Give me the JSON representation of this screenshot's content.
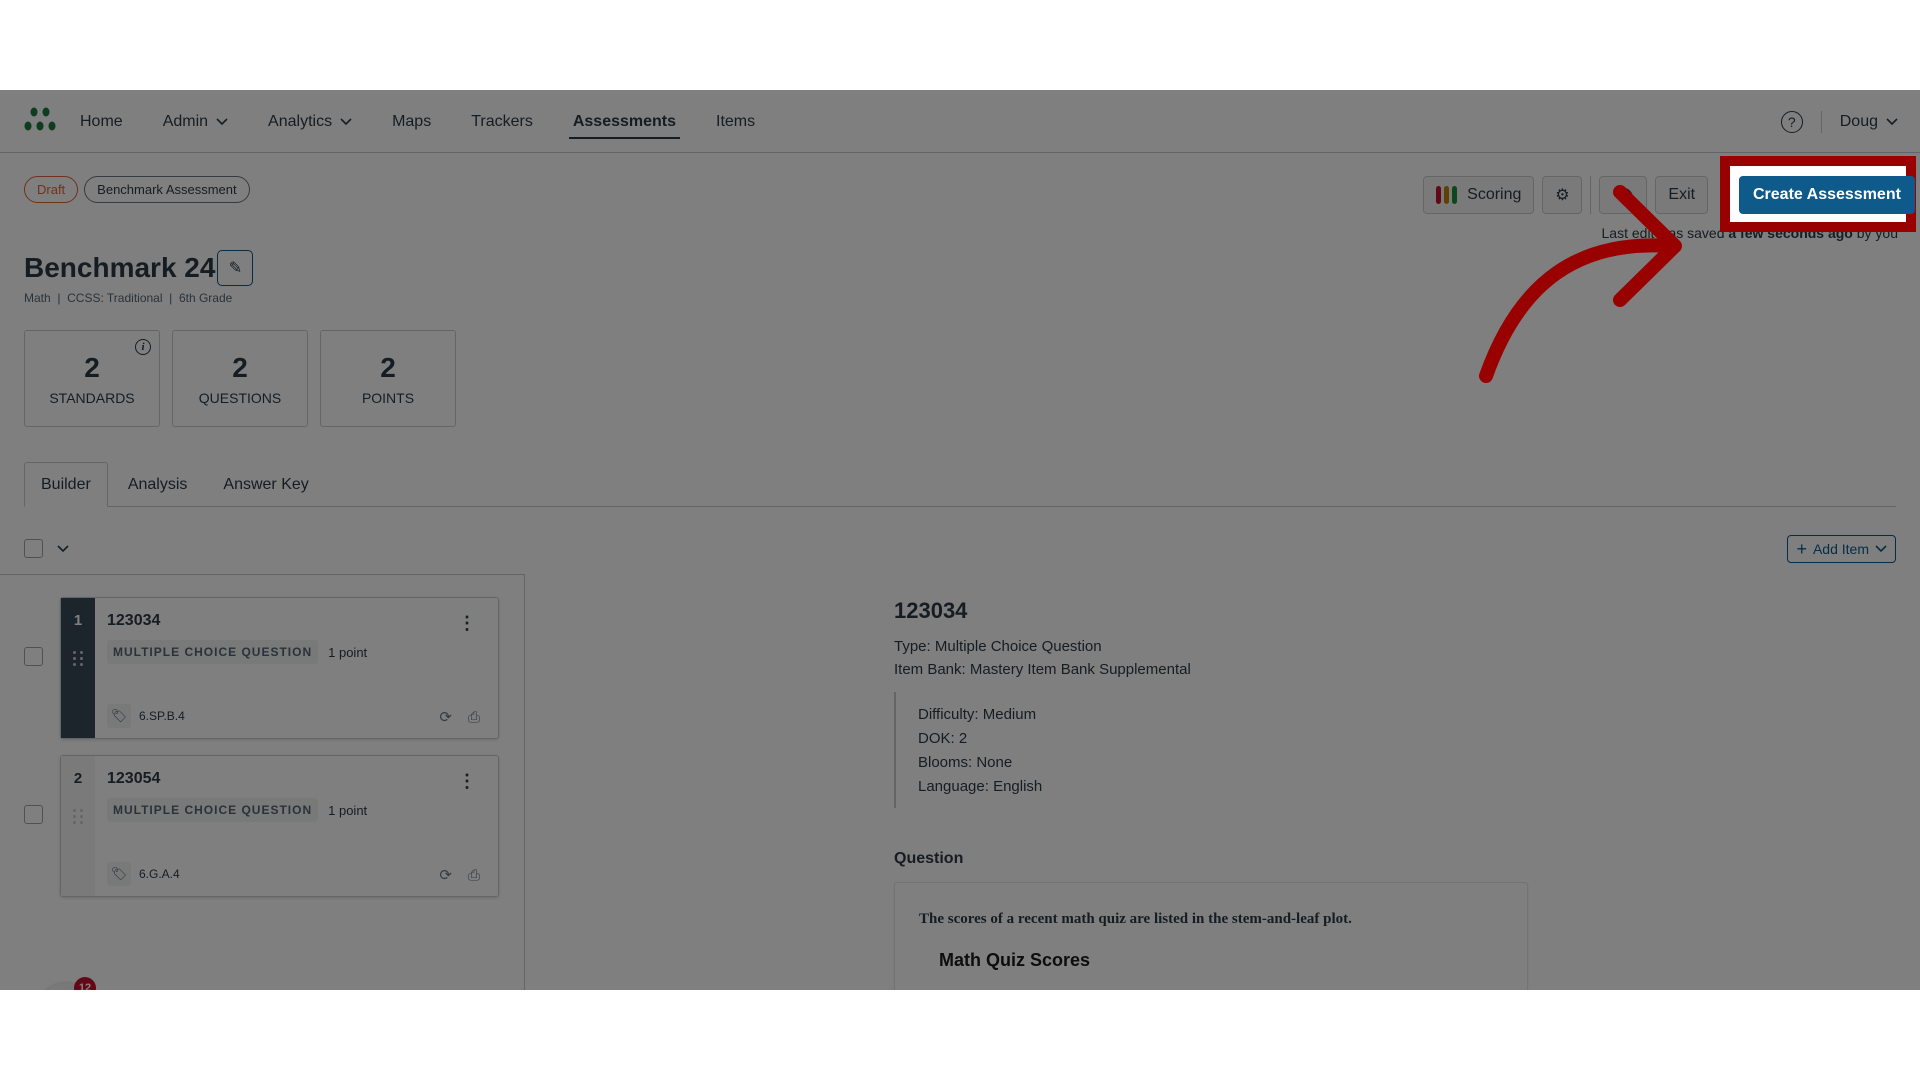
{
  "nav": {
    "items": [
      {
        "label": "Home",
        "has_dropdown": false
      },
      {
        "label": "Admin",
        "has_dropdown": true
      },
      {
        "label": "Analytics",
        "has_dropdown": true
      },
      {
        "label": "Maps",
        "has_dropdown": false
      },
      {
        "label": "Trackers",
        "has_dropdown": false
      },
      {
        "label": "Assessments",
        "has_dropdown": false,
        "active": true
      },
      {
        "label": "Items",
        "has_dropdown": false
      }
    ],
    "help_icon": "?",
    "user": "Doug"
  },
  "header": {
    "status_pill": "Draft",
    "type_pill": "Benchmark Assessment",
    "title": "Benchmark 24",
    "subtitle": "Math  |  CCSS: Traditional  |  6th Grade"
  },
  "toolbar": {
    "scoring_label": "Scoring",
    "exit_label": "Exit",
    "create_label": "Create Assessment",
    "saved_prefix": "Last edit was saved ",
    "saved_time": "a few seconds ago",
    "saved_suffix": " by you",
    "scoring_colors": [
      "#c8102e",
      "#b8860b",
      "#1e8c3a"
    ]
  },
  "stats": [
    {
      "value": "2",
      "label": "STANDARDS",
      "has_info": true
    },
    {
      "value": "2",
      "label": "QUESTIONS"
    },
    {
      "value": "2",
      "label": "POINTS"
    }
  ],
  "tabs": [
    {
      "label": "Builder",
      "active": true
    },
    {
      "label": "Analysis"
    },
    {
      "label": "Answer Key"
    }
  ],
  "list": {
    "add_item_label": "Add Item",
    "items": [
      {
        "num": "1",
        "id": "123034",
        "type": "MULTIPLE CHOICE QUESTION",
        "points": "1 point",
        "standard": "6.SP.B.4",
        "selected": true
      },
      {
        "num": "2",
        "id": "123054",
        "type": "MULTIPLE CHOICE QUESTION",
        "points": "1 point",
        "standard": "6.G.A.4",
        "selected": false
      }
    ],
    "widget_badge": "12"
  },
  "detail": {
    "id": "123034",
    "type_line": "Type: Multiple Choice Question",
    "bank_line": "Item Bank: Mastery Item Bank Supplemental",
    "meta": [
      "Difficulty: Medium",
      "DOK: 2",
      "Blooms: None",
      "Language: English"
    ],
    "question_label": "Question",
    "question_text": "The scores of a recent math quiz are listed in the stem-and-leaf plot.",
    "question_subtitle": "Math Quiz Scores"
  },
  "colors": {
    "primary": "#0e5a8a",
    "draft": "#e0623a",
    "highlight": "#990000",
    "brand_green": "#1a7a3a"
  }
}
